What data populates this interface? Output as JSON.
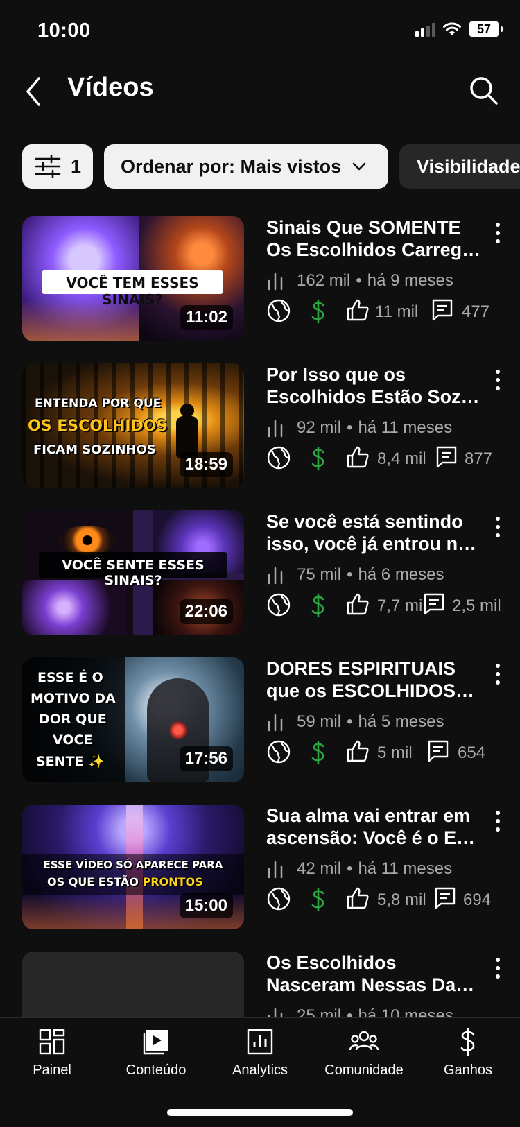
{
  "status_bar": {
    "time": "10:00",
    "battery": "57"
  },
  "header": {
    "title": "Vídeos",
    "back_icon": "back-chevron-icon",
    "search_icon": "search-icon"
  },
  "filters": {
    "filter_count": "1",
    "sort_label": "Ordenar por: Mais vistos",
    "visibility_label": "Visibilidade"
  },
  "videos": [
    {
      "title_line1": "Sinais Que SOMENTE",
      "title_line2": "Os Escolhidos Carreg…",
      "views": "162 mil",
      "age": "há 9 meses",
      "likes": "11 mil",
      "comments": "477",
      "duration": "11:02",
      "thumb_text": "VOCÊ TEM ESSES SINAIS?"
    },
    {
      "title_line1": "Por Isso que os",
      "title_line2": "Escolhidos Estão Soz…",
      "views": "92 mil",
      "age": "há 11 meses",
      "likes": "8,4 mil",
      "comments": "877",
      "duration": "18:59",
      "thumb_line1": "ENTENDA POR QUE",
      "thumb_line2": "OS ESCOLHIDOS",
      "thumb_line3": "FICAM SOZINHOS"
    },
    {
      "title_line1": "Se você está sentindo",
      "title_line2": "isso, você já entrou n…",
      "views": "75 mil",
      "age": "há 6 meses",
      "likes": "7,7 mil",
      "comments": "2,5 mil",
      "duration": "22:06",
      "thumb_text": "VOCÊ SENTE ESSES SINAIS?"
    },
    {
      "title_line1": "DORES ESPIRITUAIS",
      "title_line2": "que os ESCOLHIDOS…",
      "views": "59 mil",
      "age": "há 5 meses",
      "likes": "5 mil",
      "comments": "654",
      "duration": "17:56",
      "thumb_line1": "ESSE É O",
      "thumb_line2": "MOTIVO DA",
      "thumb_line3": "DOR QUE",
      "thumb_line4": "VOCE",
      "thumb_line5": "SENTE ✨"
    },
    {
      "title_line1": "Sua alma vai entrar em",
      "title_line2": "ascensão: Você é o E…",
      "views": "42 mil",
      "age": "há 11 meses",
      "likes": "5,8 mil",
      "comments": "694",
      "duration": "15:00",
      "thumb_line1": "ESSE VÍDEO SÓ APARECE PARA",
      "thumb_line2": "OS QUE ESTÃO",
      "thumb_highlight": "PRONTOS"
    },
    {
      "title_line1": "Os Escolhidos",
      "title_line2": "Nasceram Nessas Da…",
      "views": "25 mil",
      "age": "há 10 meses"
    }
  ],
  "bottom_nav": [
    {
      "label": "Painel",
      "icon": "dashboard-icon"
    },
    {
      "label": "Conteúdo",
      "icon": "content-icon"
    },
    {
      "label": "Analytics",
      "icon": "analytics-icon"
    },
    {
      "label": "Comunidade",
      "icon": "community-icon"
    },
    {
      "label": "Ganhos",
      "icon": "earn-icon"
    }
  ],
  "colors": {
    "background": "#0f0f0f",
    "chip_light": "#f1f1f1",
    "chip_dark": "#272727",
    "monetization_green": "#2ba640",
    "secondary_text": "#aaaaaa"
  }
}
